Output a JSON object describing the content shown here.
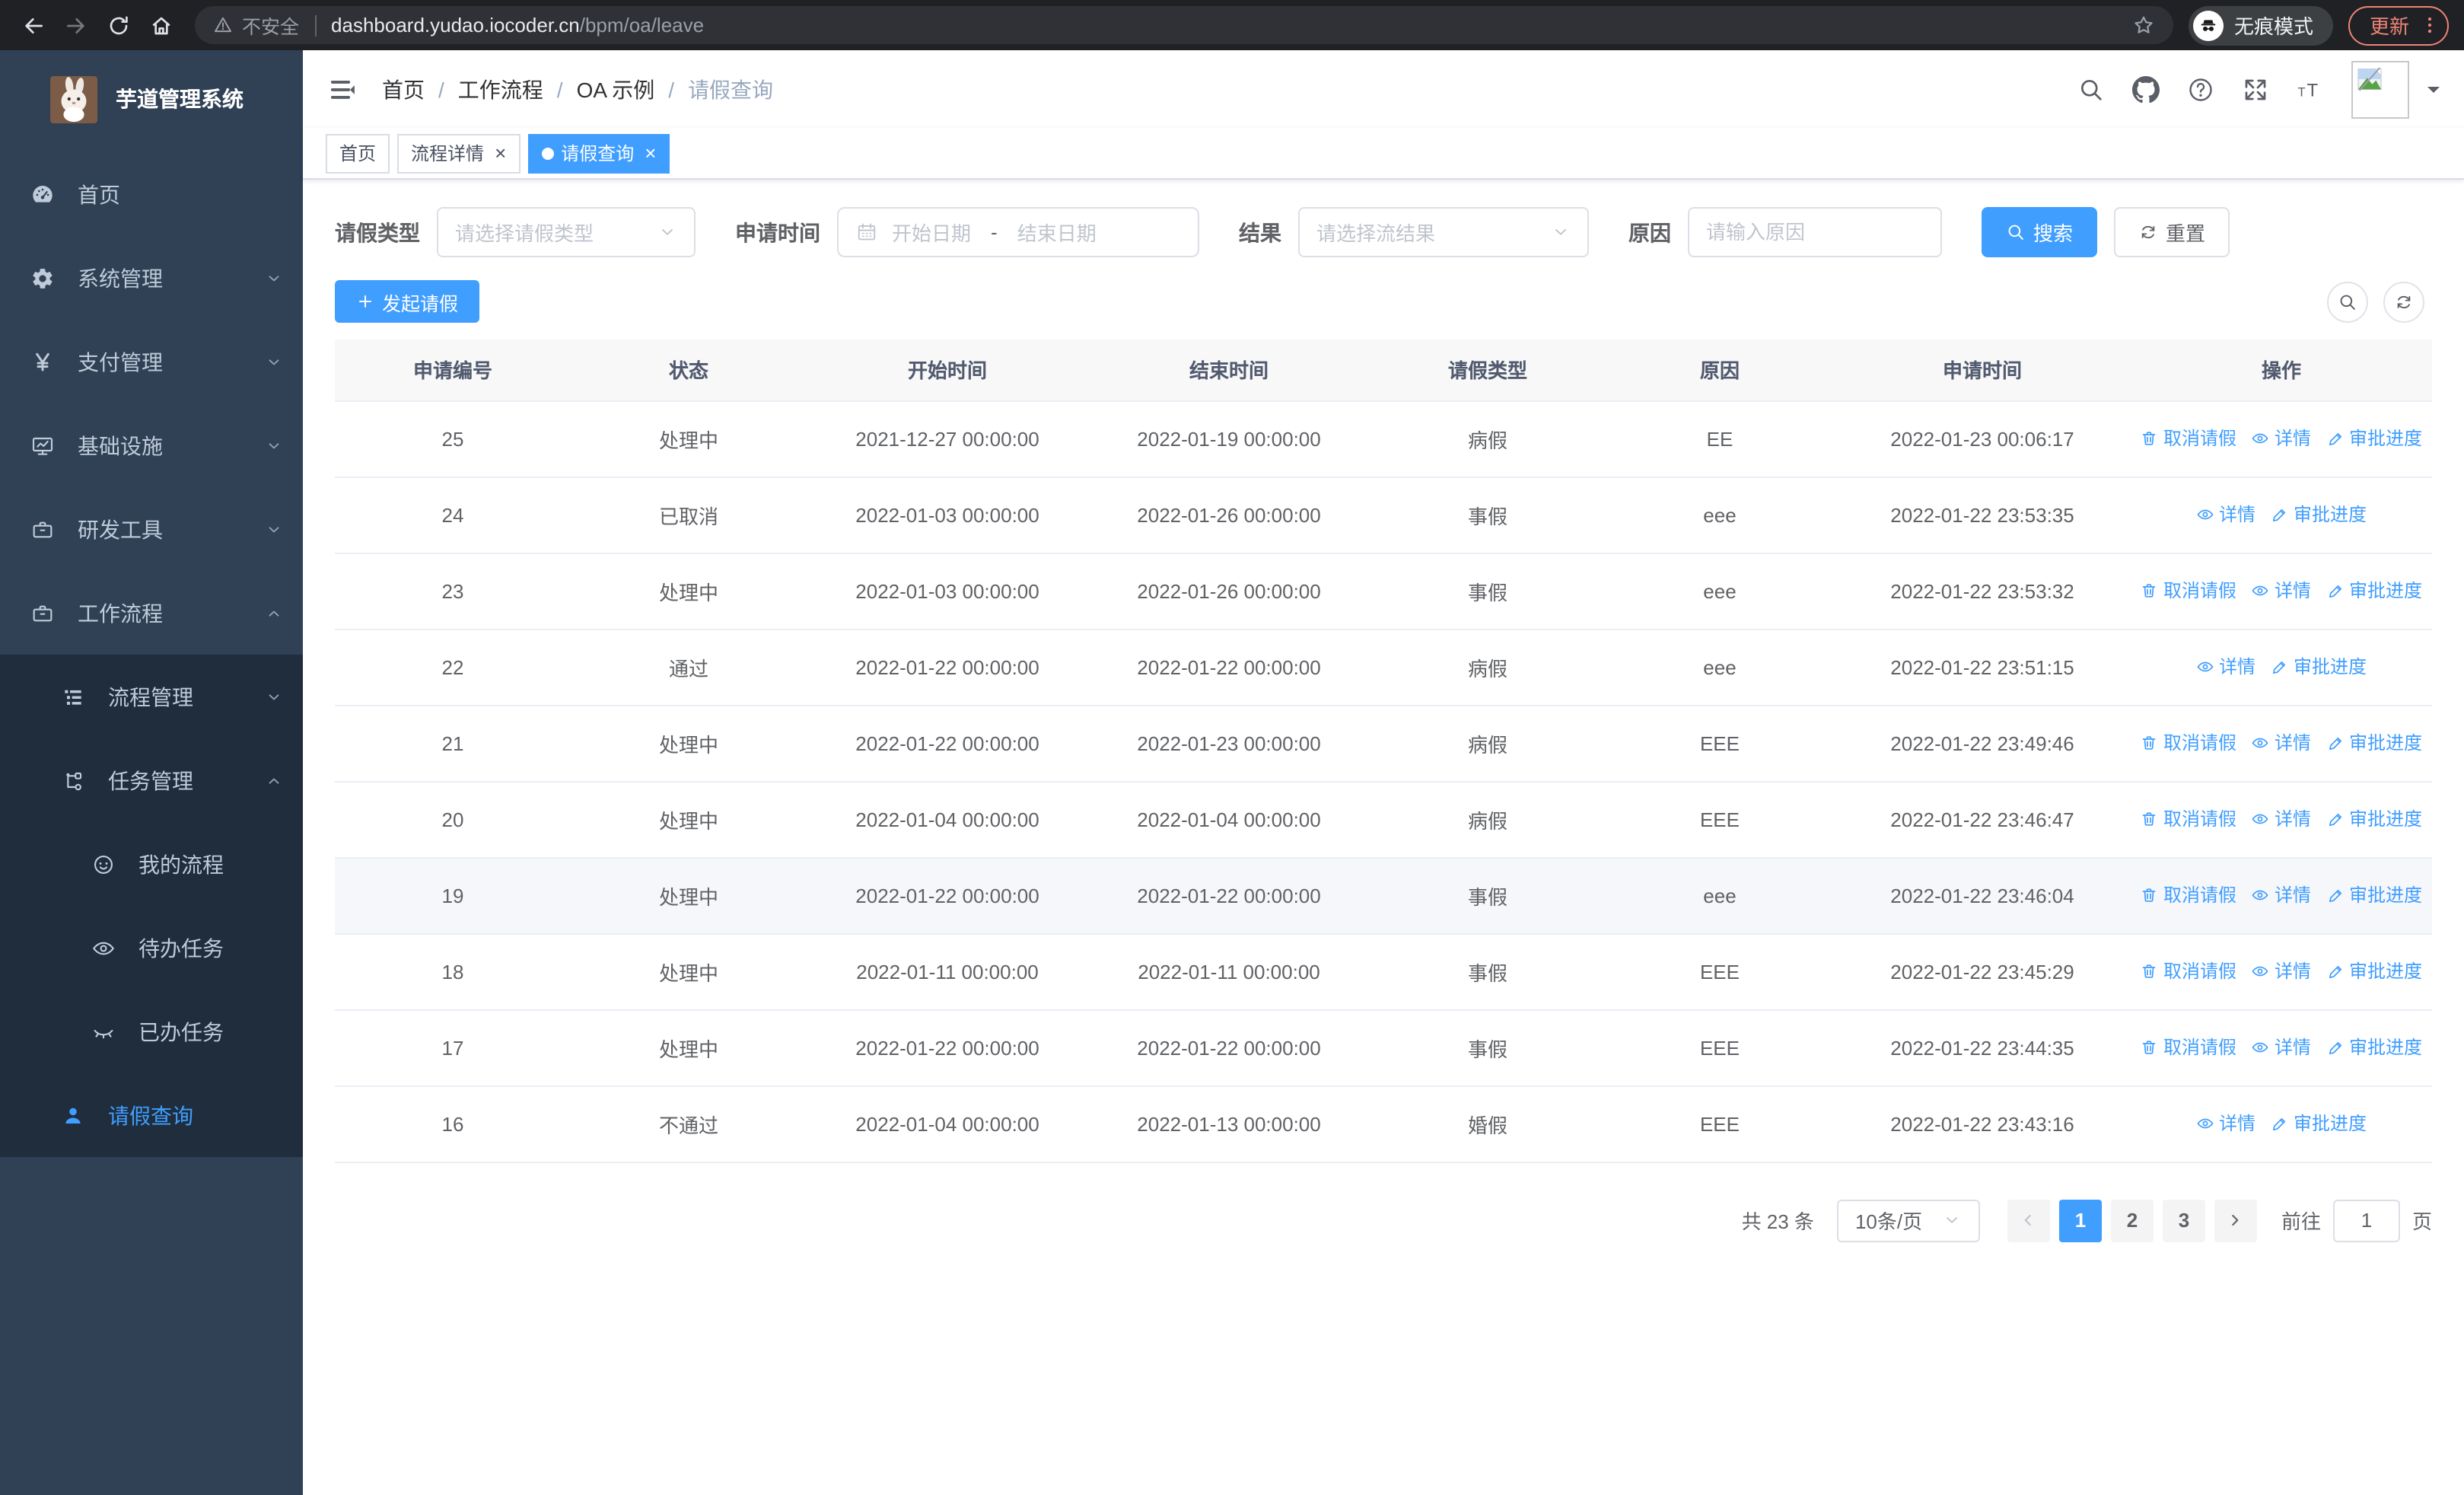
{
  "colors": {
    "primary": "#409EFF",
    "sidebar_bg": "#304156",
    "submenu_bg": "#1f2d3d",
    "sidebar_text": "#bfcbd9",
    "update_accent": "#EF8376",
    "table_header_bg": "#f8f8f9",
    "row_border": "#ebeef5"
  },
  "browser": {
    "security_label": "不安全",
    "url_host": "dashboard.yudao.iocoder.cn",
    "url_path": "/bpm/oa/leave",
    "incognito_label": "无痕模式",
    "update_label": "更新"
  },
  "sidebar": {
    "app_title": "芋道管理系统",
    "menu": [
      {
        "name": "home",
        "label": "首页",
        "icon": "dashboard-icon",
        "level": 1,
        "submenu": false
      },
      {
        "name": "system-management",
        "label": "系统管理",
        "icon": "gear-icon",
        "level": 1,
        "chevron": "down",
        "submenu": false
      },
      {
        "name": "payment-management",
        "label": "支付管理",
        "icon": "yen-icon",
        "level": 1,
        "chevron": "down",
        "submenu": false
      },
      {
        "name": "infrastructure",
        "label": "基础设施",
        "icon": "monitor-icon",
        "level": 1,
        "chevron": "down",
        "submenu": false
      },
      {
        "name": "dev-tools",
        "label": "研发工具",
        "icon": "toolbox-icon",
        "level": 1,
        "chevron": "down",
        "submenu": false
      },
      {
        "name": "workflow",
        "label": "工作流程",
        "icon": "briefcase-icon",
        "level": 1,
        "chevron": "up",
        "submenu": false
      },
      {
        "name": "process-management",
        "label": "流程管理",
        "icon": "tree-list-icon",
        "level": 2,
        "chevron": "down",
        "submenu": true
      },
      {
        "name": "task-management",
        "label": "任务管理",
        "icon": "flow-icon",
        "level": 2,
        "chevron": "up",
        "submenu": true
      },
      {
        "name": "my-process",
        "label": "我的流程",
        "icon": "face-icon",
        "level": 3,
        "submenu": true
      },
      {
        "name": "todo-tasks",
        "label": "待办任务",
        "icon": "eye-open-icon",
        "level": 3,
        "submenu": true
      },
      {
        "name": "done-tasks",
        "label": "已办任务",
        "icon": "eye-closed-icon",
        "level": 3,
        "submenu": true
      },
      {
        "name": "leave-query",
        "label": "请假查询",
        "icon": "user-icon",
        "level": 2,
        "submenu": true,
        "active": true
      }
    ]
  },
  "breadcrumb": [
    "首页",
    "工作流程",
    "OA 示例",
    "请假查询"
  ],
  "tabs": [
    {
      "name": "home",
      "label": "首页",
      "closable": false,
      "active": false
    },
    {
      "name": "process-detail",
      "label": "流程详情",
      "closable": true,
      "active": false
    },
    {
      "name": "leave-query",
      "label": "请假查询",
      "closable": true,
      "active": true
    }
  ],
  "filters": {
    "leave_type": {
      "label": "请假类型",
      "placeholder": "请选择请假类型"
    },
    "apply_time": {
      "label": "申请时间",
      "start_placeholder": "开始日期",
      "separator": "-",
      "end_placeholder": "结束日期"
    },
    "result": {
      "label": "结果",
      "placeholder": "请选择流结果"
    },
    "reason": {
      "label": "原因",
      "placeholder": "请输入原因"
    },
    "search_label": "搜索",
    "reset_label": "重置"
  },
  "toolbar": {
    "create_label": "发起请假"
  },
  "table": {
    "columns": [
      "申请编号",
      "状态",
      "开始时间",
      "结束时间",
      "请假类型",
      "原因",
      "申请时间",
      "操作"
    ],
    "action_defs": {
      "cancel": {
        "label": "取消请假",
        "icon": "trash-icon"
      },
      "detail": {
        "label": "详情",
        "icon": "eye-icon"
      },
      "progress": {
        "label": "审批进度",
        "icon": "pen-icon"
      }
    },
    "rows": [
      {
        "id": "25",
        "status": "处理中",
        "start_time": "2021-12-27 00:00:00",
        "end_time": "2022-01-19 00:00:00",
        "leave_type": "病假",
        "reason": "EE",
        "apply_time": "2022-01-23 00:06:17",
        "actions": [
          "cancel",
          "detail",
          "progress"
        ],
        "hover": false
      },
      {
        "id": "24",
        "status": "已取消",
        "start_time": "2022-01-03 00:00:00",
        "end_time": "2022-01-26 00:00:00",
        "leave_type": "事假",
        "reason": "eee",
        "apply_time": "2022-01-22 23:53:35",
        "actions": [
          "detail",
          "progress"
        ],
        "hover": false
      },
      {
        "id": "23",
        "status": "处理中",
        "start_time": "2022-01-03 00:00:00",
        "end_time": "2022-01-26 00:00:00",
        "leave_type": "事假",
        "reason": "eee",
        "apply_time": "2022-01-22 23:53:32",
        "actions": [
          "cancel",
          "detail",
          "progress"
        ],
        "hover": false
      },
      {
        "id": "22",
        "status": "通过",
        "start_time": "2022-01-22 00:00:00",
        "end_time": "2022-01-22 00:00:00",
        "leave_type": "病假",
        "reason": "eee",
        "apply_time": "2022-01-22 23:51:15",
        "actions": [
          "detail",
          "progress"
        ],
        "hover": false
      },
      {
        "id": "21",
        "status": "处理中",
        "start_time": "2022-01-22 00:00:00",
        "end_time": "2022-01-23 00:00:00",
        "leave_type": "病假",
        "reason": "EEE",
        "apply_time": "2022-01-22 23:49:46",
        "actions": [
          "cancel",
          "detail",
          "progress"
        ],
        "hover": false
      },
      {
        "id": "20",
        "status": "处理中",
        "start_time": "2022-01-04 00:00:00",
        "end_time": "2022-01-04 00:00:00",
        "leave_type": "病假",
        "reason": "EEE",
        "apply_time": "2022-01-22 23:46:47",
        "actions": [
          "cancel",
          "detail",
          "progress"
        ],
        "hover": false
      },
      {
        "id": "19",
        "status": "处理中",
        "start_time": "2022-01-22 00:00:00",
        "end_time": "2022-01-22 00:00:00",
        "leave_type": "事假",
        "reason": "eee",
        "apply_time": "2022-01-22 23:46:04",
        "actions": [
          "cancel",
          "detail",
          "progress"
        ],
        "hover": true
      },
      {
        "id": "18",
        "status": "处理中",
        "start_time": "2022-01-11 00:00:00",
        "end_time": "2022-01-11 00:00:00",
        "leave_type": "事假",
        "reason": "EEE",
        "apply_time": "2022-01-22 23:45:29",
        "actions": [
          "cancel",
          "detail",
          "progress"
        ],
        "hover": false
      },
      {
        "id": "17",
        "status": "处理中",
        "start_time": "2022-01-22 00:00:00",
        "end_time": "2022-01-22 00:00:00",
        "leave_type": "事假",
        "reason": "EEE",
        "apply_time": "2022-01-22 23:44:35",
        "actions": [
          "cancel",
          "detail",
          "progress"
        ],
        "hover": false
      },
      {
        "id": "16",
        "status": "不通过",
        "start_time": "2022-01-04 00:00:00",
        "end_time": "2022-01-13 00:00:00",
        "leave_type": "婚假",
        "reason": "EEE",
        "apply_time": "2022-01-22 23:43:16",
        "actions": [
          "detail",
          "progress"
        ],
        "hover": false
      }
    ]
  },
  "pagination": {
    "total_label": "共 23 条",
    "page_size_label": "10条/页",
    "pages": [
      1,
      2,
      3
    ],
    "active_page": 1,
    "goto_label": "前往",
    "goto_value": "1",
    "page_suffix": "页"
  }
}
